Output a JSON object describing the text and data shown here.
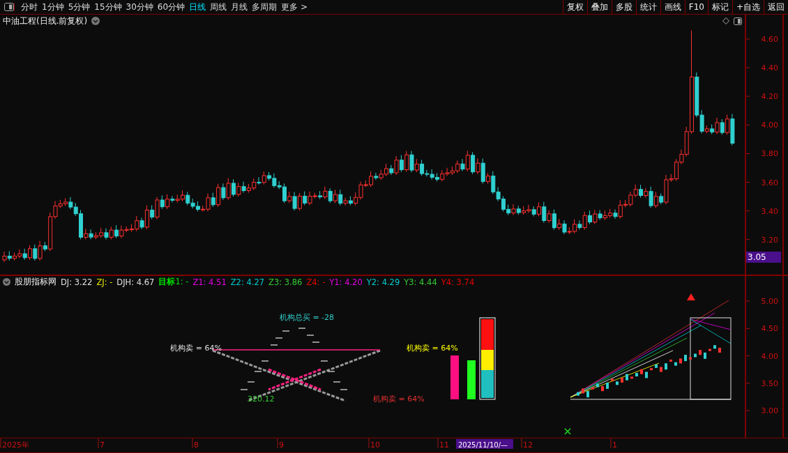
{
  "toolbar": {
    "periods": [
      {
        "label": "分时",
        "selected": false
      },
      {
        "label": "1分钟",
        "selected": false
      },
      {
        "label": "5分钟",
        "selected": false
      },
      {
        "label": "15分钟",
        "selected": false
      },
      {
        "label": "30分钟",
        "selected": false
      },
      {
        "label": "60分钟",
        "selected": false
      },
      {
        "label": "日线",
        "selected": true
      },
      {
        "label": "周线",
        "selected": false
      },
      {
        "label": "月线",
        "selected": false
      },
      {
        "label": "多周期",
        "selected": false
      },
      {
        "label": "更多 >",
        "selected": false
      }
    ],
    "actions": [
      "复权",
      "叠加",
      "多股",
      "统计",
      "画线",
      "F10",
      "标记",
      "+自选",
      "返回"
    ]
  },
  "main_chart": {
    "title": "中油工程(日线.前复权)",
    "price_ticks": [
      "4.60",
      "4.40",
      "4.20",
      "4.00",
      "3.80",
      "3.60",
      "3.40",
      "3.20"
    ],
    "current_price": "3.05"
  },
  "indicator": {
    "title": "股朋指标网",
    "values": [
      {
        "text": "DJ: 3.22",
        "color": "#e0e0e0"
      },
      {
        "text": "ZJ: -",
        "color": "#e6e600"
      },
      {
        "text": "DJH: 4.67",
        "color": "#e0e0e0"
      },
      {
        "text": "**目标**1: -",
        "color": "#00e600"
      },
      {
        "text": "Z1: 4.51",
        "color": "#e600e6"
      },
      {
        "text": "Z2: 4.27",
        "color": "#00cccc"
      },
      {
        "text": "Z3: 3.86",
        "color": "#33cc33"
      },
      {
        "text": "Z4: -",
        "color": "#e60000"
      },
      {
        "text": "Y1: 4.20",
        "color": "#e600e6"
      },
      {
        "text": "Y2: 4.29",
        "color": "#00cccc"
      },
      {
        "text": "Y3: 4.44",
        "color": "#33cc33"
      },
      {
        "text": "Y4: 3.74",
        "color": "#e60000"
      }
    ],
    "labels": [
      {
        "text": "机构总买 = -28",
        "color": "#33cccc"
      },
      {
        "text": "机构卖 = 64%",
        "color": "#e0e0e0"
      },
      {
        "text": "机构卖 = 64%",
        "color": "#ffff00"
      },
      {
        "text": "320.12",
        "color": "#33cc33"
      },
      {
        "text": "机构卖 = 64%",
        "color": "#e03030"
      }
    ],
    "ticks": [
      "5.00",
      "4.50",
      "4.00",
      "3.50",
      "3.00"
    ]
  },
  "time_axis": {
    "labels": [
      "2025年",
      "7",
      "8",
      "9",
      "10",
      "11",
      "12",
      "1"
    ],
    "cursor_date": "2025/11/10/—"
  }
}
